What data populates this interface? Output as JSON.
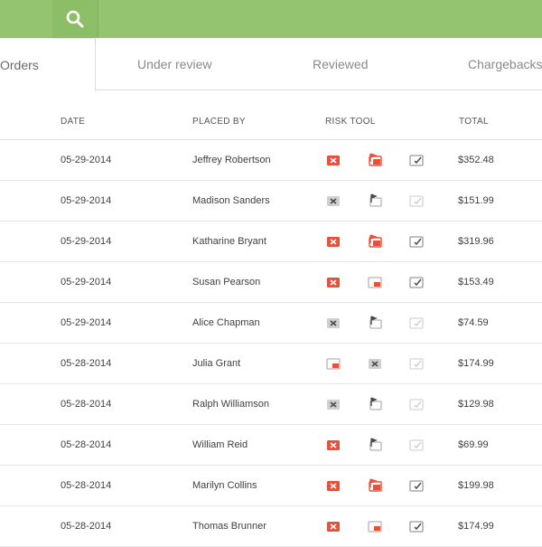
{
  "colors": {
    "topbar": "#94c46f",
    "alert_red": "#e8503a",
    "icon_gray": "#9b9b9b",
    "icon_dark": "#4a4a4a"
  },
  "search": {
    "icon": "search-icon"
  },
  "tabs": [
    {
      "label": "Orders",
      "active": true
    },
    {
      "label": "Under review",
      "active": false
    },
    {
      "label": "Reviewed",
      "active": false
    },
    {
      "label": "Chargebacks",
      "active": false
    }
  ],
  "table": {
    "headers": {
      "date": "DATE",
      "placed_by": "PLACED BY",
      "risk_tool": "RISK TOOL",
      "total": "TOTAL"
    },
    "rows": [
      {
        "date": "05-29-2014",
        "name": "Jeffrey Robertson",
        "total": "$352.48",
        "risk": [
          "red-x",
          "red-flag",
          "gray-check"
        ]
      },
      {
        "date": "05-29-2014",
        "name": "Madison Sanders",
        "total": "$151.99",
        "risk": [
          "gray-x",
          "dark-flag",
          "light-check"
        ]
      },
      {
        "date": "05-29-2014",
        "name": "Katharine Bryant",
        "total": "$319.96",
        "risk": [
          "red-x",
          "red-flag",
          "gray-check"
        ]
      },
      {
        "date": "05-29-2014",
        "name": "Susan Pearson",
        "total": "$153.49",
        "risk": [
          "red-x",
          "red-doc",
          "gray-check"
        ]
      },
      {
        "date": "05-29-2014",
        "name": "Alice Chapman",
        "total": "$74.59",
        "risk": [
          "gray-x",
          "dark-flag",
          "light-check"
        ]
      },
      {
        "date": "05-28-2014",
        "name": "Julia Grant",
        "total": "$174.99",
        "risk": [
          "red-doc",
          "gray-x",
          "light-check"
        ]
      },
      {
        "date": "05-28-2014",
        "name": "Ralph Williamson",
        "total": "$129.98",
        "risk": [
          "gray-x",
          "dark-flag",
          "light-check"
        ]
      },
      {
        "date": "05-28-2014",
        "name": "William Reid",
        "total": "$69.99",
        "risk": [
          "red-x",
          "dark-flag",
          "light-check"
        ]
      },
      {
        "date": "05-28-2014",
        "name": "Marilyn Collins",
        "total": "$199.98",
        "risk": [
          "red-x",
          "red-flag",
          "gray-check"
        ]
      },
      {
        "date": "05-28-2014",
        "name": "Thomas Brunner",
        "total": "$174.99",
        "risk": [
          "red-x",
          "red-doc",
          "gray-check"
        ]
      }
    ]
  }
}
